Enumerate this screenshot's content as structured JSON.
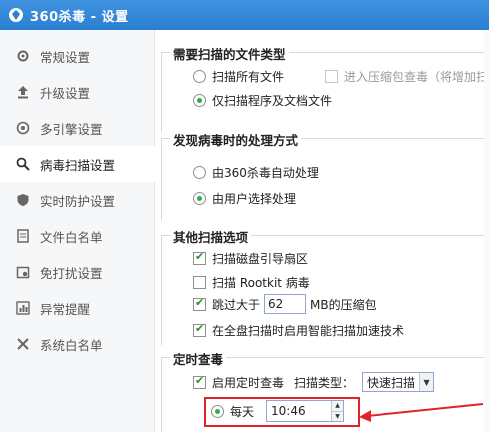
{
  "window": {
    "title": "360杀毒 - 设置"
  },
  "sidebar": {
    "items": [
      {
        "label": "常规设置",
        "icon": "gear-icon"
      },
      {
        "label": "升级设置",
        "icon": "upload-icon"
      },
      {
        "label": "多引擎设置",
        "icon": "engine-icon"
      },
      {
        "label": "病毒扫描设置",
        "icon": "search-icon",
        "active": true
      },
      {
        "label": "实时防护设置",
        "icon": "shield-icon"
      },
      {
        "label": "文件白名单",
        "icon": "document-icon"
      },
      {
        "label": "免打扰设置",
        "icon": "calendar-icon"
      },
      {
        "label": "异常提醒",
        "icon": "chart-icon"
      },
      {
        "label": "系统白名单",
        "icon": "tools-icon"
      }
    ]
  },
  "file_types": {
    "title": "需要扫描的文件类型",
    "scan_all": "扫描所有文件",
    "scan_archive": "进入压缩包查毒（将增加扫",
    "scan_programs": "仅扫描程序及文档文件",
    "selected": "scan_programs"
  },
  "virus_action": {
    "title": "发现病毒时的处理方式",
    "auto": "由360杀毒自动处理",
    "user": "由用户选择处理",
    "selected": "user"
  },
  "other_options": {
    "title": "其他扫描选项",
    "boot_sector": "扫描磁盘引导扇区",
    "boot_sector_checked": true,
    "rootkit": "扫描 Rootkit 病毒",
    "rootkit_checked": false,
    "skip_prefix": "跳过大于",
    "skip_size": "62",
    "skip_suffix": "MB的压缩包",
    "skip_checked": true,
    "smart_accel": "在全盘扫描时启用智能扫描加速技术",
    "smart_accel_checked": true
  },
  "scheduled": {
    "title": "定时查毒",
    "enable": "启用定时查毒",
    "enable_checked": true,
    "scan_type_label": "扫描类型：",
    "scan_type_value": "快速扫描",
    "daily": "每天",
    "daily_selected": true,
    "time": "10:46"
  },
  "colors": {
    "titlebar": "#2a7fd2",
    "highlight": "#e0232b",
    "radio_dot": "#2fae3f"
  }
}
